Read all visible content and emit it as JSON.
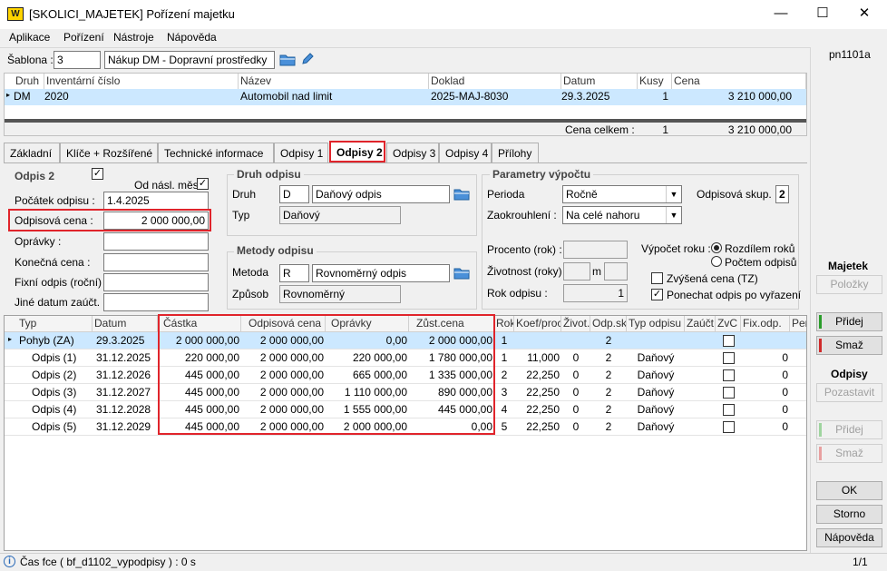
{
  "window": {
    "title": "[SKOLICI_MAJETEK] Pořízení majetku",
    "code": "pn1101a"
  },
  "menu": [
    "Aplikace",
    "Pořízení",
    "Nástroje",
    "Nápověda"
  ],
  "sablona": {
    "label": "Šablona :",
    "number": "3",
    "name": "Nákup DM - Dopravní prostředky"
  },
  "top_table": {
    "headers": [
      "Druh",
      "Inventární číslo",
      "Název",
      "Doklad",
      "Datum",
      "Kusy",
      "Cena"
    ],
    "row": [
      "DM",
      "2020",
      "Automobil nad limit",
      "2025-MAJ-8030",
      "29.3.2025",
      "1",
      "3 210 000,00"
    ],
    "total_label": "Cena celkem :",
    "total_kusy": "1",
    "total_cena": "3 210 000,00"
  },
  "tabs": [
    "Základní",
    "Klíče + Rozšířené",
    "Technické informace",
    "Odpisy 1",
    "Odpisy 2",
    "Odpisy 3",
    "Odpisy 4",
    "Přílohy"
  ],
  "odpis": {
    "title": "Odpis 2",
    "od_nasl": "Od násl. měs.",
    "pocatek_label": "Počátek odpisu :",
    "pocatek": "1.4.2025",
    "cena_label": "Odpisová cena :",
    "cena": "2 000 000,00",
    "opravky_label": "Oprávky :",
    "konecna_label": "Konečná cena :",
    "fixni_label": "Fixní odpis (roční) :",
    "jine_label": "Jiné datum zaúčt. :"
  },
  "druh_odpisu": {
    "title": "Druh odpisu",
    "druh_label": "Druh",
    "druh_code": "D",
    "druh_name": "Daňový odpis",
    "typ_label": "Typ",
    "typ": "Daňový"
  },
  "metody": {
    "title": "Metody odpisu",
    "metoda_label": "Metoda",
    "metoda_code": "R",
    "metoda_name": "Rovnoměrný odpis",
    "zpusob_label": "Způsob",
    "zpusob": "Rovnoměrný"
  },
  "parametry": {
    "title": "Parametry výpočtu",
    "perioda_label": "Perioda",
    "perioda": "Ročně",
    "skup_label": "Odpisová skup. :",
    "skup": "2",
    "zaokr_label": "Zaokrouhlení :",
    "zaokr": "Na celé nahoru",
    "procento_label": "Procento (rok) :",
    "zivotnost_label": "Životnost (roky)",
    "m_label": "m",
    "rok_label": "Rok odpisu :",
    "rok": "1",
    "vypocet_label": "Výpočet roku :",
    "radio1": "Rozdílem roků",
    "radio2": "Počtem odpisů",
    "zvysena": "Zvýšená cena (TZ)",
    "ponechat": "Ponechat odpis po vyřazení"
  },
  "grid": {
    "headers": [
      "Typ",
      "Datum",
      "Částka",
      "Odpisová cena",
      "Oprávky",
      "Zůst.cena",
      "Rok",
      "Koef/proc",
      "Život.",
      "Odp.sk.",
      "Typ odpisu",
      "Zaúčt.",
      "ZvC",
      "Fix.odp.",
      "Per"
    ],
    "rows": [
      [
        "Pohyb (ZA)",
        "29.3.2025",
        "2 000 000,00",
        "2 000 000,00",
        "0,00",
        "2 000 000,00",
        "1",
        "",
        "",
        "2",
        "",
        "",
        "",
        ""
      ],
      [
        "Odpis (1)",
        "31.12.2025",
        "220 000,00",
        "2 000 000,00",
        "220 000,00",
        "1 780 000,00",
        "1",
        "11,000",
        "0",
        "2",
        "Daňový",
        "",
        "",
        "0"
      ],
      [
        "Odpis (2)",
        "31.12.2026",
        "445 000,00",
        "2 000 000,00",
        "665 000,00",
        "1 335 000,00",
        "2",
        "22,250",
        "0",
        "2",
        "Daňový",
        "",
        "",
        "0"
      ],
      [
        "Odpis (3)",
        "31.12.2027",
        "445 000,00",
        "2 000 000,00",
        "1 110 000,00",
        "890 000,00",
        "3",
        "22,250",
        "0",
        "2",
        "Daňový",
        "",
        "",
        "0"
      ],
      [
        "Odpis (4)",
        "31.12.2028",
        "445 000,00",
        "2 000 000,00",
        "1 555 000,00",
        "445 000,00",
        "4",
        "22,250",
        "0",
        "2",
        "Daňový",
        "",
        "",
        "0"
      ],
      [
        "Odpis (5)",
        "31.12.2029",
        "445 000,00",
        "2 000 000,00",
        "2 000 000,00",
        "0,00",
        "5",
        "22,250",
        "0",
        "2",
        "Daňový",
        "",
        "",
        "0"
      ]
    ]
  },
  "side": {
    "majetek": "Majetek",
    "polozky": "Položky",
    "pridej": "Přidej",
    "smaz": "Smaž",
    "odpisy": "Odpisy",
    "pozastavit": "Pozastavit",
    "pridej2": "Přidej",
    "smaz2": "Smaž",
    "ok": "OK",
    "storno": "Storno",
    "napoveda": "Nápověda"
  },
  "status": {
    "text": "Čas fce ( bf_d1102_vypodpisy ) : 0 s",
    "page": "1/1"
  },
  "colors": {
    "selected_row": "#cce8ff",
    "highlight": "#e0242b"
  }
}
